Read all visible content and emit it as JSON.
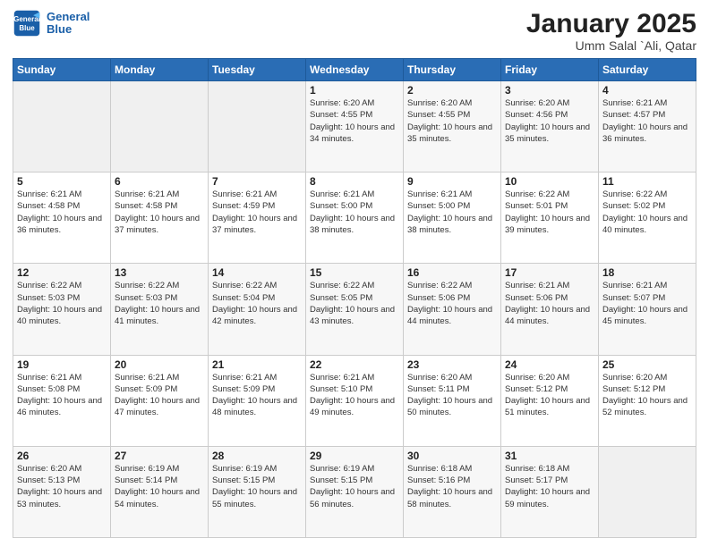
{
  "header": {
    "logo_line1": "General",
    "logo_line2": "Blue",
    "title": "January 2025",
    "subtitle": "Umm Salal `Ali, Qatar"
  },
  "weekdays": [
    "Sunday",
    "Monday",
    "Tuesday",
    "Wednesday",
    "Thursday",
    "Friday",
    "Saturday"
  ],
  "weeks": [
    [
      {
        "day": "",
        "sunrise": "",
        "sunset": "",
        "daylight": "",
        "empty": true
      },
      {
        "day": "",
        "sunrise": "",
        "sunset": "",
        "daylight": "",
        "empty": true
      },
      {
        "day": "",
        "sunrise": "",
        "sunset": "",
        "daylight": "",
        "empty": true
      },
      {
        "day": "1",
        "sunrise": "Sunrise: 6:20 AM",
        "sunset": "Sunset: 4:55 PM",
        "daylight": "Daylight: 10 hours and 34 minutes."
      },
      {
        "day": "2",
        "sunrise": "Sunrise: 6:20 AM",
        "sunset": "Sunset: 4:55 PM",
        "daylight": "Daylight: 10 hours and 35 minutes."
      },
      {
        "day": "3",
        "sunrise": "Sunrise: 6:20 AM",
        "sunset": "Sunset: 4:56 PM",
        "daylight": "Daylight: 10 hours and 35 minutes."
      },
      {
        "day": "4",
        "sunrise": "Sunrise: 6:21 AM",
        "sunset": "Sunset: 4:57 PM",
        "daylight": "Daylight: 10 hours and 36 minutes."
      }
    ],
    [
      {
        "day": "5",
        "sunrise": "Sunrise: 6:21 AM",
        "sunset": "Sunset: 4:58 PM",
        "daylight": "Daylight: 10 hours and 36 minutes."
      },
      {
        "day": "6",
        "sunrise": "Sunrise: 6:21 AM",
        "sunset": "Sunset: 4:58 PM",
        "daylight": "Daylight: 10 hours and 37 minutes."
      },
      {
        "day": "7",
        "sunrise": "Sunrise: 6:21 AM",
        "sunset": "Sunset: 4:59 PM",
        "daylight": "Daylight: 10 hours and 37 minutes."
      },
      {
        "day": "8",
        "sunrise": "Sunrise: 6:21 AM",
        "sunset": "Sunset: 5:00 PM",
        "daylight": "Daylight: 10 hours and 38 minutes."
      },
      {
        "day": "9",
        "sunrise": "Sunrise: 6:21 AM",
        "sunset": "Sunset: 5:00 PM",
        "daylight": "Daylight: 10 hours and 38 minutes."
      },
      {
        "day": "10",
        "sunrise": "Sunrise: 6:22 AM",
        "sunset": "Sunset: 5:01 PM",
        "daylight": "Daylight: 10 hours and 39 minutes."
      },
      {
        "day": "11",
        "sunrise": "Sunrise: 6:22 AM",
        "sunset": "Sunset: 5:02 PM",
        "daylight": "Daylight: 10 hours and 40 minutes."
      }
    ],
    [
      {
        "day": "12",
        "sunrise": "Sunrise: 6:22 AM",
        "sunset": "Sunset: 5:03 PM",
        "daylight": "Daylight: 10 hours and 40 minutes."
      },
      {
        "day": "13",
        "sunrise": "Sunrise: 6:22 AM",
        "sunset": "Sunset: 5:03 PM",
        "daylight": "Daylight: 10 hours and 41 minutes."
      },
      {
        "day": "14",
        "sunrise": "Sunrise: 6:22 AM",
        "sunset": "Sunset: 5:04 PM",
        "daylight": "Daylight: 10 hours and 42 minutes."
      },
      {
        "day": "15",
        "sunrise": "Sunrise: 6:22 AM",
        "sunset": "Sunset: 5:05 PM",
        "daylight": "Daylight: 10 hours and 43 minutes."
      },
      {
        "day": "16",
        "sunrise": "Sunrise: 6:22 AM",
        "sunset": "Sunset: 5:06 PM",
        "daylight": "Daylight: 10 hours and 44 minutes."
      },
      {
        "day": "17",
        "sunrise": "Sunrise: 6:21 AM",
        "sunset": "Sunset: 5:06 PM",
        "daylight": "Daylight: 10 hours and 44 minutes."
      },
      {
        "day": "18",
        "sunrise": "Sunrise: 6:21 AM",
        "sunset": "Sunset: 5:07 PM",
        "daylight": "Daylight: 10 hours and 45 minutes."
      }
    ],
    [
      {
        "day": "19",
        "sunrise": "Sunrise: 6:21 AM",
        "sunset": "Sunset: 5:08 PM",
        "daylight": "Daylight: 10 hours and 46 minutes."
      },
      {
        "day": "20",
        "sunrise": "Sunrise: 6:21 AM",
        "sunset": "Sunset: 5:09 PM",
        "daylight": "Daylight: 10 hours and 47 minutes."
      },
      {
        "day": "21",
        "sunrise": "Sunrise: 6:21 AM",
        "sunset": "Sunset: 5:09 PM",
        "daylight": "Daylight: 10 hours and 48 minutes."
      },
      {
        "day": "22",
        "sunrise": "Sunrise: 6:21 AM",
        "sunset": "Sunset: 5:10 PM",
        "daylight": "Daylight: 10 hours and 49 minutes."
      },
      {
        "day": "23",
        "sunrise": "Sunrise: 6:20 AM",
        "sunset": "Sunset: 5:11 PM",
        "daylight": "Daylight: 10 hours and 50 minutes."
      },
      {
        "day": "24",
        "sunrise": "Sunrise: 6:20 AM",
        "sunset": "Sunset: 5:12 PM",
        "daylight": "Daylight: 10 hours and 51 minutes."
      },
      {
        "day": "25",
        "sunrise": "Sunrise: 6:20 AM",
        "sunset": "Sunset: 5:12 PM",
        "daylight": "Daylight: 10 hours and 52 minutes."
      }
    ],
    [
      {
        "day": "26",
        "sunrise": "Sunrise: 6:20 AM",
        "sunset": "Sunset: 5:13 PM",
        "daylight": "Daylight: 10 hours and 53 minutes."
      },
      {
        "day": "27",
        "sunrise": "Sunrise: 6:19 AM",
        "sunset": "Sunset: 5:14 PM",
        "daylight": "Daylight: 10 hours and 54 minutes."
      },
      {
        "day": "28",
        "sunrise": "Sunrise: 6:19 AM",
        "sunset": "Sunset: 5:15 PM",
        "daylight": "Daylight: 10 hours and 55 minutes."
      },
      {
        "day": "29",
        "sunrise": "Sunrise: 6:19 AM",
        "sunset": "Sunset: 5:15 PM",
        "daylight": "Daylight: 10 hours and 56 minutes."
      },
      {
        "day": "30",
        "sunrise": "Sunrise: 6:18 AM",
        "sunset": "Sunset: 5:16 PM",
        "daylight": "Daylight: 10 hours and 58 minutes."
      },
      {
        "day": "31",
        "sunrise": "Sunrise: 6:18 AM",
        "sunset": "Sunset: 5:17 PM",
        "daylight": "Daylight: 10 hours and 59 minutes."
      },
      {
        "day": "",
        "sunrise": "",
        "sunset": "",
        "daylight": "",
        "empty": true
      }
    ]
  ]
}
